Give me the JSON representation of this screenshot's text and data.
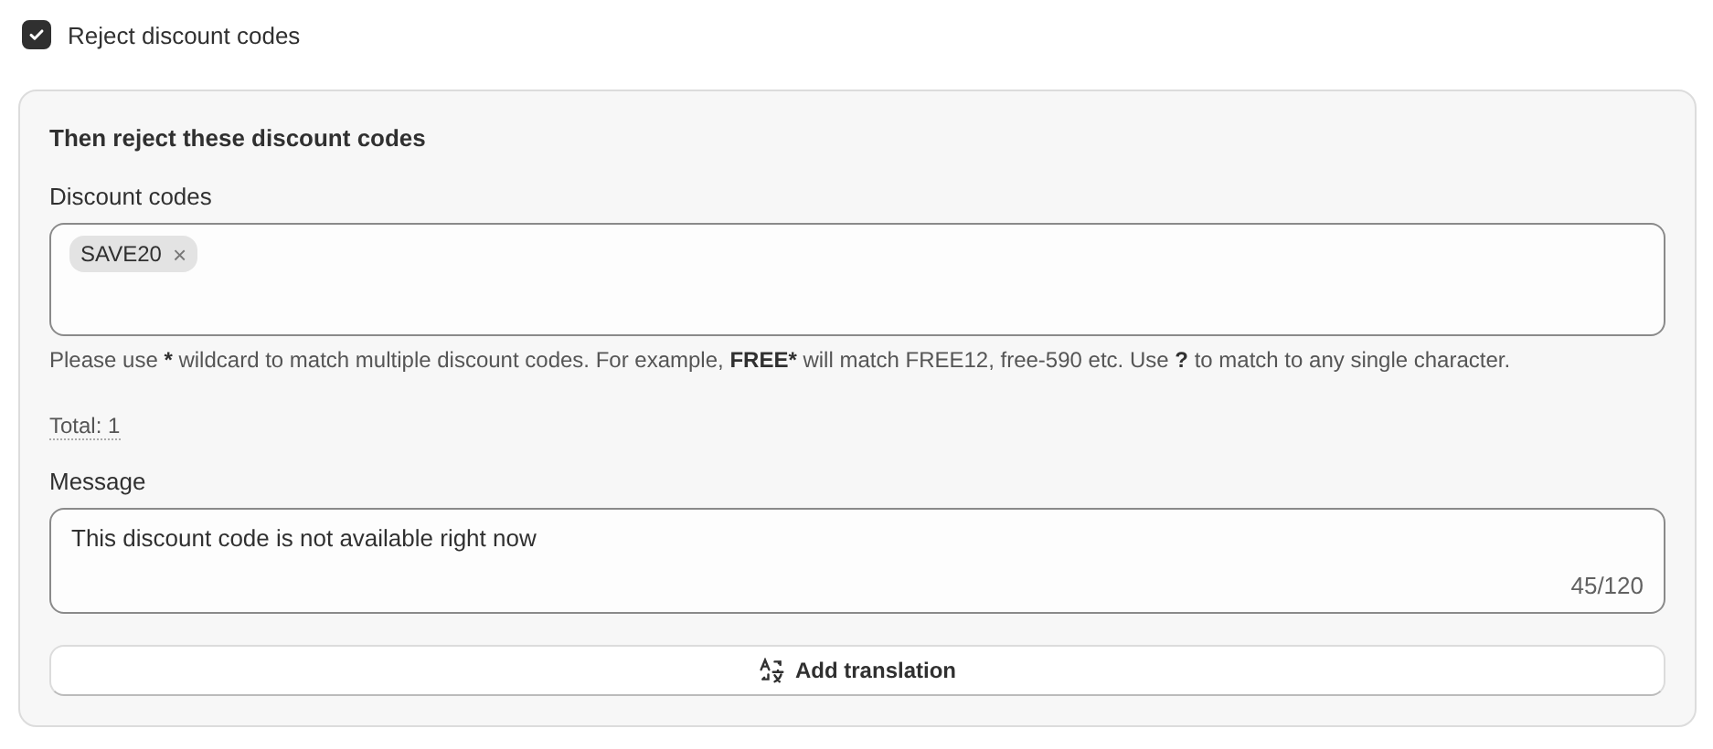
{
  "option": {
    "label": "Reject discount codes",
    "checked": true
  },
  "section": {
    "title": "Then reject these discount codes",
    "codes_field": {
      "label": "Discount codes",
      "tags": [
        "SAVE20"
      ],
      "remove_icon": "×"
    },
    "help": [
      {
        "text": "Please use ",
        "bold": false
      },
      {
        "text": "*",
        "bold": true
      },
      {
        "text": " wildcard to match multiple discount codes. For example, ",
        "bold": false
      },
      {
        "text": "FREE*",
        "bold": true
      },
      {
        "text": " will match FREE12, free-590 etc. Use ",
        "bold": false
      },
      {
        "text": "?",
        "bold": true
      },
      {
        "text": " to match to any single character.",
        "bold": false
      }
    ],
    "total": "Total: 1",
    "message_field": {
      "label": "Message",
      "value": "This discount code is not available right now",
      "counter": "45/120"
    },
    "button": "Add translation"
  }
}
